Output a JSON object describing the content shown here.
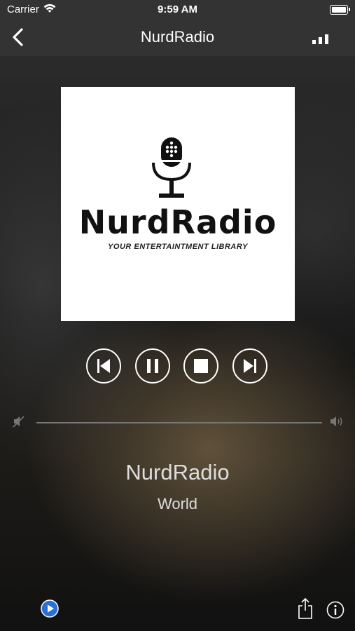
{
  "status_bar": {
    "carrier": "Carrier",
    "time": "9:59 AM"
  },
  "nav": {
    "title": "NurdRadio",
    "back_icon": "chevron-left-icon",
    "signal_icon": "signal-bars-icon"
  },
  "artwork": {
    "logo_text": "NurdRadio",
    "tagline": "YOUR ENTERTAINTMENT LIBRARY"
  },
  "controls": [
    "previous",
    "pause",
    "stop",
    "next"
  ],
  "volume": {
    "level": 1.0
  },
  "station": {
    "name": "NurdRadio",
    "region": "World"
  },
  "colors": {
    "bar": "#333333",
    "text": "#ffffff",
    "label": "#dddddd"
  }
}
